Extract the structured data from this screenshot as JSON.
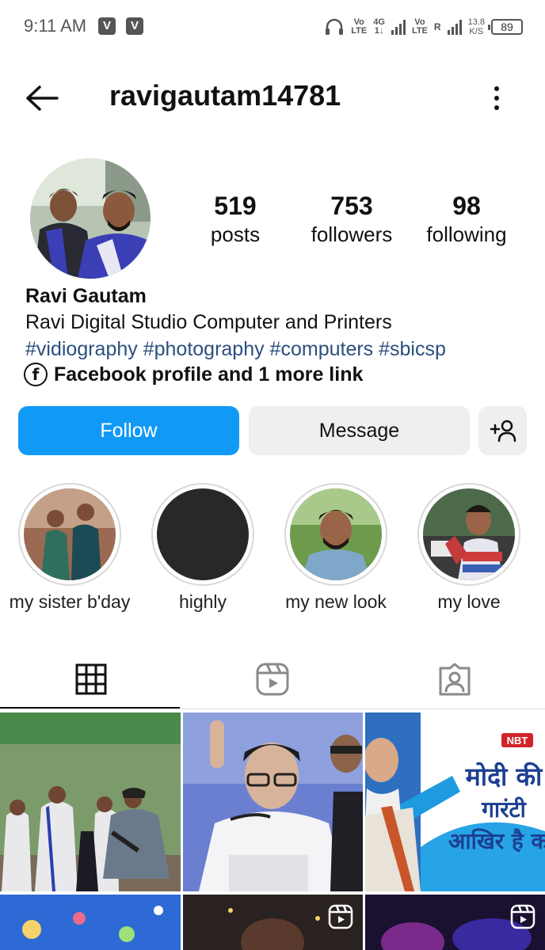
{
  "status_bar": {
    "time": "9:11 AM",
    "badge_1": "V",
    "badge_2": "V",
    "net_1_top": "Vo",
    "net_1_bottom": "LTE",
    "net_2_top": "4G",
    "net_2_bottom": "1↓",
    "net_3_top": "Vo",
    "net_3_bottom": "LTE",
    "net_4_top": "R",
    "speed_value": "13.8",
    "speed_unit": "K/S",
    "battery": "89"
  },
  "header": {
    "username": "ravigautam14781",
    "back_icon": "arrow-left-icon",
    "more_icon": "more-vertical-icon"
  },
  "profile": {
    "stats": [
      {
        "value": "519",
        "label": "posts"
      },
      {
        "value": "753",
        "label": "followers"
      },
      {
        "value": "98",
        "label": "following"
      }
    ],
    "display_name": "Ravi Gautam",
    "bio": "Ravi Digital Studio Computer and Printers",
    "hashtags": "#vidiography #photography #computers #sbicsp",
    "link_text": "Facebook profile and 1 more link",
    "link_icon": "facebook-icon"
  },
  "actions": {
    "follow_label": "Follow",
    "message_label": "Message",
    "add_user_icon": "add-user-icon",
    "follow_color": "#1199f6"
  },
  "highlights": [
    {
      "label": "my sister b'day"
    },
    {
      "label": "highly"
    },
    {
      "label": "my new look"
    },
    {
      "label": "my love"
    }
  ],
  "tabs": [
    {
      "icon": "grid-icon",
      "active": true
    },
    {
      "icon": "reels-icon",
      "active": false
    },
    {
      "icon": "tagged-icon",
      "active": false
    }
  ],
  "grid": {
    "post_3_banner": "NBT",
    "post_3_headline_1": "मोदी की",
    "post_3_headline_2": "गारंटी",
    "post_3_headline_3": "आखिर है क"
  }
}
